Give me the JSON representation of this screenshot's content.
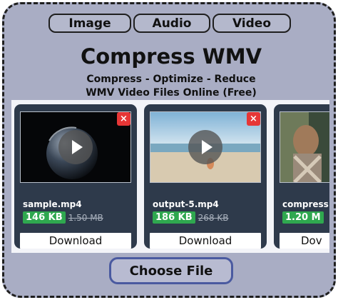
{
  "tabs": [
    {
      "label": "Image"
    },
    {
      "label": "Audio"
    },
    {
      "label": "Video"
    }
  ],
  "title": "Compress WMV",
  "subtitle_line1": "Compress - Optimize - Reduce",
  "subtitle_line2": "WMV Video Files Online (Free)",
  "files": [
    {
      "name": "sample.mp4",
      "new_size": "146 KB",
      "old_size": "1.50 MB",
      "download_label": "Download",
      "close_icon": "×"
    },
    {
      "name": "output-5.mp4",
      "new_size": "186 KB",
      "old_size": "268 KB",
      "download_label": "Download",
      "close_icon": "×"
    },
    {
      "name": "compress",
      "new_size": "1.20 M",
      "download_label": "Dov"
    }
  ],
  "choose_file_label": "Choose File",
  "colors": {
    "panel": "#a9adc4",
    "card": "#2e3a4b",
    "size_badge": "#2fa84f",
    "close_button": "#e63636",
    "choose_border": "#4a5aa0"
  }
}
